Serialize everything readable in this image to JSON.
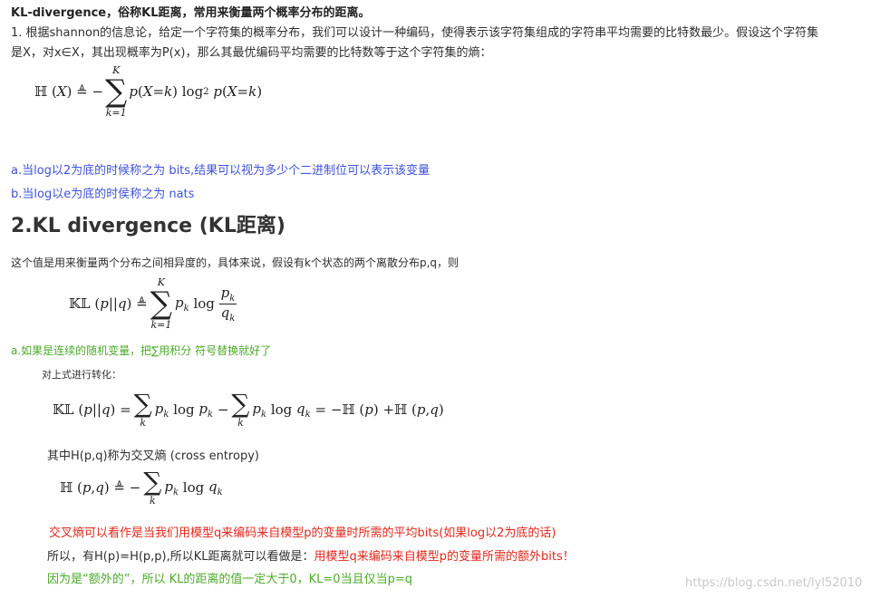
{
  "heading1": "KL-divergence，俗称KL距离，常用来衡量两个概率分布的距离。",
  "para1_line1": "1. 根据shannon的信息论，给定一个字符集的概率分布，我们可以设计一种编码，使得表示该字符集组成的字符串平均需要的比特数最少。假设这个字符集",
  "para1_line2": "是X，对x∈X，其出现概率为P(x)，那么其最优编码平均需要的比特数等于这个字符集的熵：",
  "note_a": "a.当log以2为底的时候称之为 bits,结果可以视为多少个二进制位可以表示该变量",
  "note_b": "b.当log以e为底的时侯称之为 nats",
  "heading2": "2.KL divergence (KL距离)",
  "para2": "这个值是用来衡量两个分布之间相异度的，具体来说，假设有k个状态的两个离散分布p,q，则",
  "note_green_a": "a.如果是连续的随机变量，把∑用积分 符号替换就好了",
  "transform_label": "对上式进行转化：",
  "cross_entropy_label": "其中H(p,q)称为交叉熵 (cross entropy)",
  "red_line": "交叉熵可以看作是当我们用模型q来编码来自模型p的变量时所需的平均bits(如果log以2为底的话)",
  "so_prefix": "所以，有H(p)=H(p,p),所以KL距离就可以看做是：",
  "so_red": "用模型q来编码来自模型p的变量所需的额外bits！",
  "green_final": "因为是“额外的”，所以 KL的距离的值一定大于0，KL=0当且仅当p=q",
  "watermark": "https://blog.csdn.net/lyl52010",
  "colors": {
    "blue": "#3f51d8",
    "green": "#4caa2a",
    "red": "#e0281e"
  }
}
